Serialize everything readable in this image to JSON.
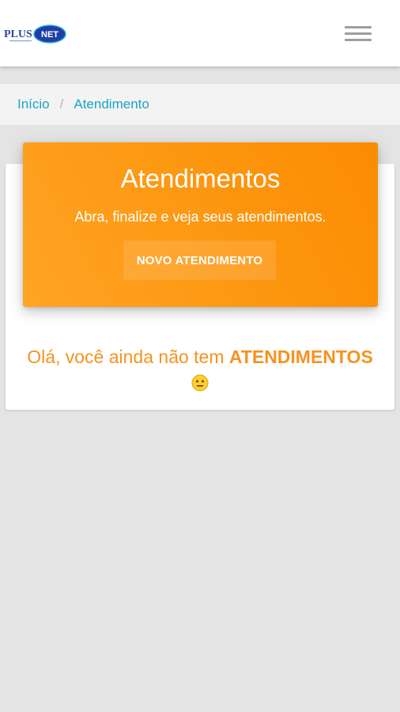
{
  "header": {
    "logo_text": "PLUS NET",
    "menu_icon": "hamburger-menu-icon"
  },
  "breadcrumb": {
    "items": [
      "Início",
      "Atendimento"
    ],
    "separator": "/"
  },
  "hero": {
    "title": "Atendimentos",
    "subtitle": "Abra, finalize e veja seus atendimentos.",
    "button_label": "NOVO ATENDIMENTO"
  },
  "empty_state": {
    "prefix": "Olá, você ainda não tem",
    "highlight": "ATENDIMENTOS",
    "emoji_icon": "neutral-face-icon"
  },
  "colors": {
    "accent_orange": "#fb8c00",
    "link_blue": "#1aa3c8",
    "background": "#e4e4e4"
  }
}
